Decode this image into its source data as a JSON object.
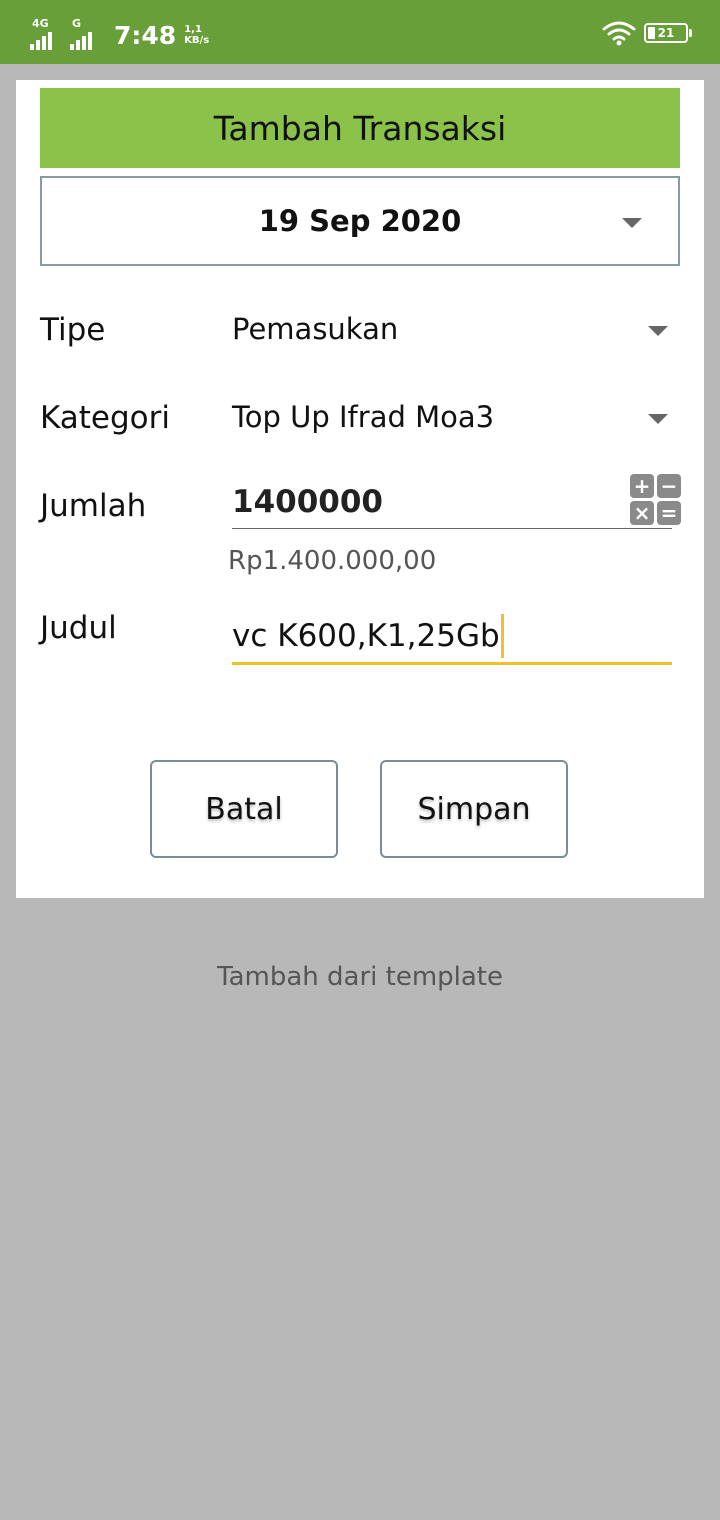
{
  "status_bar": {
    "network_1": "4G",
    "network_2": "G",
    "time": "7:48",
    "speed_value": "1,1",
    "speed_unit": "KB/s",
    "battery": "21",
    "battery_level": 0.21
  },
  "dialog": {
    "title": "Tambah Transaksi",
    "date": "19 Sep 2020",
    "fields": {
      "type_label": "Tipe",
      "type_value": "Pemasukan",
      "category_label": "Kategori",
      "category_value": "Top Up Ifrad Moa3",
      "amount_label": "Jumlah",
      "amount_value": "1400000",
      "amount_formatted": "Rp1.400.000,00",
      "title_label": "Judul",
      "title_value": "vc K600,K1,25Gb"
    },
    "calculator_keys": [
      "+",
      "−",
      "×",
      "="
    ],
    "buttons": {
      "cancel": "Batal",
      "save": "Simpan"
    }
  },
  "template_link": "Tambah dari template",
  "colors": {
    "status_bar": "#689f38",
    "header": "#8bc34a",
    "focus_underline": "#f0c22a",
    "backdrop": "#b8b8b8"
  }
}
